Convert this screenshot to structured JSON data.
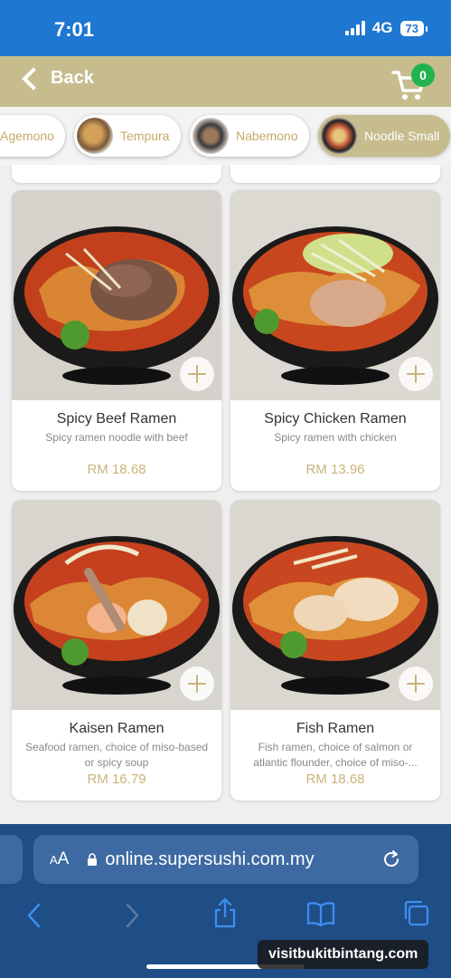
{
  "status_bar": {
    "time": "7:01",
    "network": "4G",
    "battery": "73"
  },
  "header": {
    "back_label": "Back",
    "cart_count": "0"
  },
  "categories": [
    {
      "label": "Agemono",
      "active": false
    },
    {
      "label": "Tempura",
      "active": false
    },
    {
      "label": "Nabemono",
      "active": false
    },
    {
      "label": "Noodle Small",
      "active": true
    }
  ],
  "products": [
    {
      "name": "Spicy Beef Ramen",
      "desc": "Spicy ramen noodle with beef",
      "price": "RM 18.68"
    },
    {
      "name": "Spicy Chicken Ramen",
      "desc": "Spicy ramen with chicken",
      "price": "RM 13.96"
    },
    {
      "name": "Kaisen Ramen",
      "desc": "Seafood ramen, choice of miso-based or spicy soup",
      "price": "RM 16.79"
    },
    {
      "name": "Fish Ramen",
      "desc": "Fish ramen, choice of salmon or atlantic flounder, choice of miso-...",
      "price": "RM 18.68"
    }
  ],
  "browser": {
    "aa_label": "AA",
    "url": "online.supersushi.com.my"
  },
  "watermark": "visitbukitbintang.com",
  "colors": {
    "status_bar": "#1e77d1",
    "header": "#c6bc8e",
    "price": "#c8b47a",
    "cart_badge": "#22b351",
    "browser": "#1f4d86"
  }
}
